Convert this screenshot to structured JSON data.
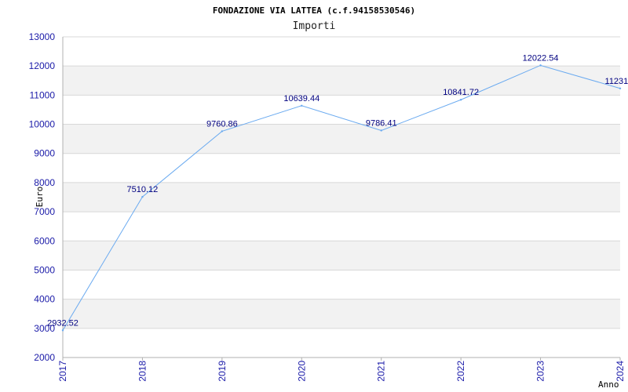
{
  "chart_data": {
    "type": "line",
    "title": "FONDAZIONE VIA LATTEA (c.f.94158530546)",
    "subtitle": "Importi",
    "xlabel": "Anno",
    "ylabel": "Euro",
    "x": [
      "2017",
      "2018",
      "2019",
      "2020",
      "2021",
      "2022",
      "2023",
      "2024"
    ],
    "series": [
      {
        "values": [
          2932.52,
          7510.12,
          9760.86,
          10639.44,
          9786.41,
          10841.72,
          12022.54,
          11231.0
        ],
        "labels": [
          "2932.52",
          "7510.12",
          "9760.86",
          "10639.44",
          "9786.41",
          "10841.72",
          "12022.54",
          "11231.0"
        ]
      }
    ],
    "ylim": [
      2000,
      13000
    ],
    "yticks": [
      "2000",
      "3000",
      "4000",
      "5000",
      "6000",
      "7000",
      "8000",
      "9000",
      "10000",
      "11000",
      "12000",
      "13000"
    ],
    "grid": true,
    "colors": {
      "line": "#6aaaf0",
      "band": "#f2f2f2",
      "gridline": "#d8d8d8",
      "axis": "#b0b0b0",
      "tick_text": "#1a1aa8",
      "data_label": "#000080"
    }
  }
}
